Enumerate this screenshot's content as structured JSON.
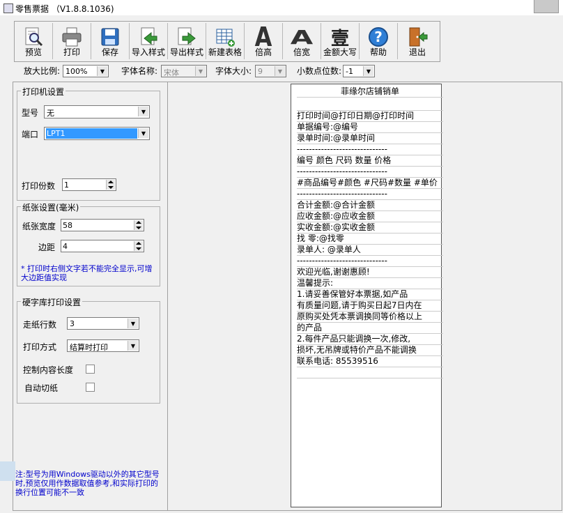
{
  "window": {
    "title": "零售票据 （V1.8.8.1036)"
  },
  "toolbar": {
    "buttons": [
      {
        "label": "预览"
      },
      {
        "label": "打印"
      },
      {
        "label": "保存"
      },
      {
        "label": "导入样式"
      },
      {
        "label": "导出样式"
      },
      {
        "label": "新建表格"
      },
      {
        "label": "倍高"
      },
      {
        "label": "倍宽"
      },
      {
        "label": "金额大写"
      },
      {
        "label": "帮助"
      },
      {
        "label": "退出"
      }
    ],
    "glyphs": {
      "double_height": "A",
      "double_width": "A",
      "amount_caps": "壹",
      "help": "?"
    }
  },
  "options": {
    "zoom_label": "放大比例:",
    "zoom_value": "100%",
    "font_name_label": "字体名称:",
    "font_name_value": "宋体",
    "font_size_label": "字体大小:",
    "font_size_value": "9",
    "decimal_label": "小数点位数:",
    "decimal_value": "-1"
  },
  "printer": {
    "title": "打印机设置",
    "model_label": "型号",
    "model_value": "无",
    "port_label": "端口",
    "port_value": "LPT1",
    "copies_label": "打印份数",
    "copies_value": "1"
  },
  "paper": {
    "title": "纸张设置(毫米)",
    "width_label": "纸张宽度",
    "width_value": "58",
    "margin_label": "边距",
    "margin_value": "4",
    "note": "* 打印时右侧文字若不能完全显示,可增大边距值实现"
  },
  "font_print": {
    "title": "硬字库打印设置",
    "feed_label": "走纸行数",
    "feed_value": "3",
    "mode_label": "打印方式",
    "mode_value": "结算时打印",
    "limit_label": "控制内容长度",
    "limit_checked": false,
    "cut_label": "自动切纸",
    "cut_checked": false
  },
  "bottom_note": "注:型号为用Windows驱动以外的其它型号时,预览仅用作数据取值参考,和实际打印的换行位置可能不一致",
  "receipt": {
    "title": "菲缘尔店铺销单",
    "lines": [
      "",
      "打印时间@打印日期@打印时间",
      "单据编号:@编号",
      "录单时间:@录单时间",
      "------------------------------",
      "编号      颜色  尺码  数量   价格",
      "------------------------------",
      "#商品编号#颜色  #尺码#数量  #单价",
      "------------------------------",
      "合计金额:@合计金额",
      "应收金额:@应收金额",
      "实收金额:@实收金额",
      "找    零:@找零",
      "录单人:  @录单人",
      "------------------------------",
      "欢迎光临,谢谢惠顾!",
      "温馨提示:",
      "1.请妥善保管好本票据,如产品",
      "有质量问题,请于购买日起7日内在",
      "原购买处凭本票调换同等价格以上",
      "的产品",
      "2.每件产品只能调换一次,修改,",
      "损坏,无吊牌或特价产品不能调换",
      "联系电话: 85539516",
      ""
    ]
  }
}
